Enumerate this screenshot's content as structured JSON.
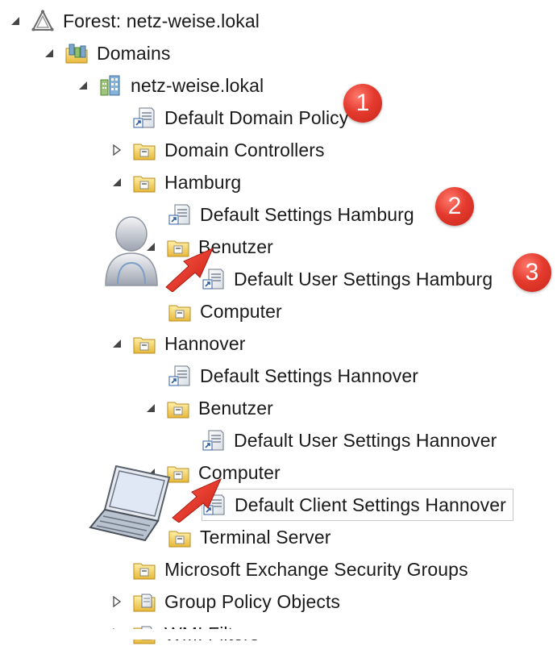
{
  "tree": {
    "forest_label": "Forest: netz-weise.lokal",
    "domains_label": "Domains",
    "domain_label": "netz-weise.lokal",
    "default_domain_policy": "Default Domain Policy",
    "domain_controllers": "Domain Controllers",
    "hamburg": {
      "label": "Hamburg",
      "default_settings": "Default Settings Hamburg",
      "benutzer": "Benutzer",
      "default_user_settings": "Default User Settings Hamburg",
      "computer": "Computer"
    },
    "hannover": {
      "label": "Hannover",
      "default_settings": "Default Settings Hannover",
      "benutzer": "Benutzer",
      "default_user_settings": "Default User Settings Hannover",
      "computer": "Computer",
      "default_client_settings": "Default Client Settings Hannover",
      "terminal_server": "Terminal Server"
    },
    "exchange_groups": "Microsoft Exchange Security Groups",
    "gpo": "Group Policy Objects",
    "wmi_filters": "WMI Filters"
  },
  "badges": {
    "one": "1",
    "two": "2",
    "three": "3"
  },
  "icons": {
    "forest": "forest-triangle-icon",
    "domains": "domains-folder-icon",
    "domain": "domain-building-icon",
    "gpo_link": "gpo-link-icon",
    "ou": "organizational-unit-folder-icon",
    "user_overlay": "user-avatar-icon",
    "laptop_overlay": "laptop-icon",
    "arrow": "red-arrow-icon"
  },
  "colors": {
    "badge_red": "#e53b2f",
    "arrow_red": "#d9362b",
    "folder_yellow": "#f2cf5b",
    "selection_border": "#c9c9c9"
  }
}
